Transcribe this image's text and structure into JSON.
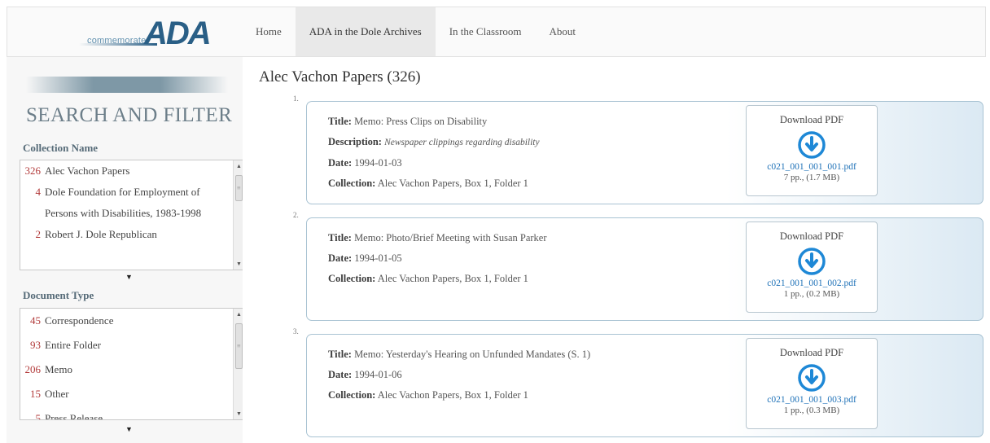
{
  "brand": {
    "small": "commemorate",
    "big": "ADA"
  },
  "nav": [
    "Home",
    "ADA in the Dole Archives",
    "In the Classroom",
    "About"
  ],
  "sidebar": {
    "heading": "SEARCH AND FILTER",
    "collection": {
      "title": "Collection Name",
      "items": [
        {
          "count": "326",
          "label": "Alec Vachon Papers"
        },
        {
          "count": "4",
          "label": "Dole Foundation for Employment of Persons with Disabilities, 1983-1998"
        },
        {
          "count": "2",
          "label": "Robert J. Dole Republican"
        }
      ]
    },
    "doctype": {
      "title": "Document Type",
      "items": [
        {
          "count": "45",
          "label": "Correspondence"
        },
        {
          "count": "93",
          "label": "Entire Folder"
        },
        {
          "count": "206",
          "label": "Memo"
        },
        {
          "count": "15",
          "label": "Other"
        },
        {
          "count": "5",
          "label": "Press Release"
        }
      ]
    }
  },
  "main": {
    "heading": "Alec Vachon Papers (326)",
    "labels": {
      "title": "Title:",
      "description": "Description:",
      "date": "Date:",
      "collection": "Collection:"
    },
    "download_label": "Download PDF",
    "records": [
      {
        "num": "1.",
        "title": "Memo: Press Clips on Disability",
        "description": "Newspaper clippings regarding disability",
        "date": "1994-01-03",
        "collection": "Alec Vachon Papers, Box 1, Folder 1",
        "file": "c021_001_001_001.pdf",
        "size": "7 pp., (1.7 MB)"
      },
      {
        "num": "2.",
        "title": "Memo: Photo/Brief Meeting with Susan Parker",
        "date": "1994-01-05",
        "collection": "Alec Vachon Papers, Box 1, Folder 1",
        "file": "c021_001_001_002.pdf",
        "size": "1 pp., (0.2 MB)"
      },
      {
        "num": "3.",
        "title": "Memo: Yesterday's Hearing on Unfunded Mandates (S. 1)",
        "date": "1994-01-06",
        "collection": "Alec Vachon Papers, Box 1, Folder 1",
        "file": "c021_001_001_003.pdf",
        "size": "1 pp., (0.3 MB)"
      }
    ]
  },
  "colors": {
    "accent": "#2a5f86",
    "link": "#1f72b8",
    "count": "#b23a3a",
    "card_border": "#a9c3d3",
    "download_icon": "#1e88d6"
  }
}
